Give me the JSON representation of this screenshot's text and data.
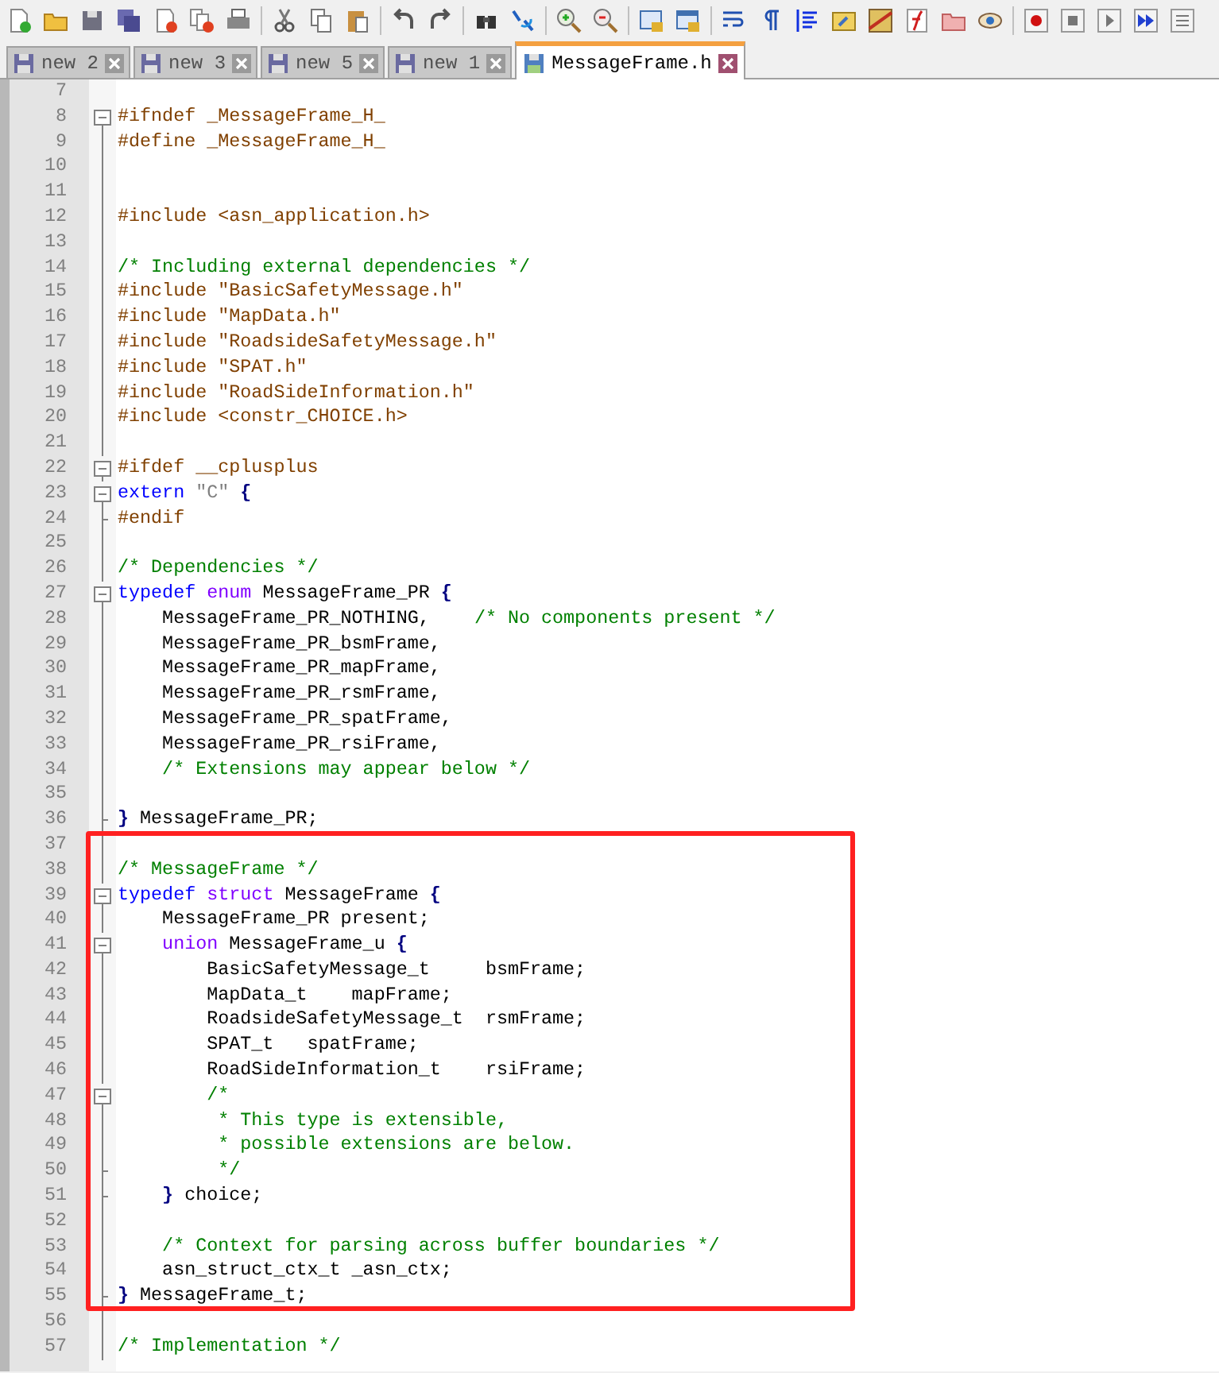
{
  "tabs": [
    {
      "label": "new 2",
      "selected": false
    },
    {
      "label": "new 3",
      "selected": false
    },
    {
      "label": "new 5",
      "selected": false
    },
    {
      "label": "new 1",
      "selected": false
    },
    {
      "label": "MessageFrame.h",
      "selected": true
    }
  ],
  "editor": {
    "lines": [
      {
        "number": "7",
        "kind": "plain"
      },
      {
        "number": "8",
        "kind": "opener",
        "segments": [
          {
            "kind": "preprocessor",
            "text": "#ifndef _MessageFrame_H_"
          }
        ]
      },
      {
        "number": "9",
        "kind": "plain",
        "segments": [
          {
            "kind": "preprocessor",
            "text": "#define _MessageFrame_H_"
          }
        ]
      },
      {
        "number": "10",
        "kind": "plain"
      },
      {
        "number": "11",
        "kind": "plain"
      },
      {
        "number": "12",
        "kind": "plain",
        "segments": [
          {
            "kind": "preprocessor",
            "text": "#include <asn_application.h>"
          }
        ]
      },
      {
        "number": "13",
        "kind": "plain"
      },
      {
        "number": "14",
        "kind": "plain",
        "segments": [
          {
            "kind": "comment",
            "text": "/* Including external dependencies */"
          }
        ]
      },
      {
        "number": "15",
        "kind": "plain",
        "segments": [
          {
            "kind": "preprocessor",
            "text": "#include \"BasicSafetyMessage.h\""
          }
        ]
      },
      {
        "number": "16",
        "kind": "plain",
        "segments": [
          {
            "kind": "preprocessor",
            "text": "#include \"MapData.h\""
          }
        ]
      },
      {
        "number": "17",
        "kind": "plain",
        "segments": [
          {
            "kind": "preprocessor",
            "text": "#include \"RoadsideSafetyMessage.h\""
          }
        ]
      },
      {
        "number": "18",
        "kind": "plain",
        "segments": [
          {
            "kind": "preprocessor",
            "text": "#include \"SPAT.h\""
          }
        ]
      },
      {
        "number": "19",
        "kind": "plain",
        "segments": [
          {
            "kind": "preprocessor",
            "text": "#include \"RoadSideInformation.h\""
          }
        ]
      },
      {
        "number": "20",
        "kind": "plain",
        "segments": [
          {
            "kind": "preprocessor",
            "text": "#include <constr_CHOICE.h>"
          }
        ]
      },
      {
        "number": "21",
        "kind": "plain"
      },
      {
        "number": "22",
        "kind": "opener",
        "segments": [
          {
            "kind": "preprocessor",
            "text": "#ifdef __cplusplus"
          }
        ]
      },
      {
        "number": "23",
        "kind": "opener",
        "segments": [
          {
            "kind": "keyword",
            "text": "extern"
          },
          {
            "kind": "string",
            "text": " \"C\" "
          },
          {
            "kind": "brace",
            "text": "{"
          }
        ]
      },
      {
        "number": "24",
        "kind": "closer",
        "segments": [
          {
            "kind": "preprocessor",
            "text": "#endif"
          }
        ]
      },
      {
        "number": "25",
        "kind": "plain"
      },
      {
        "number": "26",
        "kind": "plain",
        "segments": [
          {
            "kind": "comment",
            "text": "/* Dependencies */"
          }
        ]
      },
      {
        "number": "27",
        "kind": "opener",
        "segments": [
          {
            "kind": "keyword",
            "text": "typedef"
          },
          {
            "kind": "type",
            "text": " enum"
          },
          {
            "kind": "plain",
            "text": " MessageFrame_PR "
          },
          {
            "kind": "brace",
            "text": "{"
          }
        ]
      },
      {
        "number": "28",
        "kind": "plain",
        "segments": [
          {
            "kind": "plain",
            "text": "    MessageFrame_PR_NOTHING,    "
          },
          {
            "kind": "comment",
            "text": "/* No components present */"
          }
        ]
      },
      {
        "number": "29",
        "kind": "plain",
        "segments": [
          {
            "kind": "plain",
            "text": "    MessageFrame_PR_bsmFrame,"
          }
        ]
      },
      {
        "number": "30",
        "kind": "plain",
        "segments": [
          {
            "kind": "plain",
            "text": "    MessageFrame_PR_mapFrame,"
          }
        ]
      },
      {
        "number": "31",
        "kind": "plain",
        "segments": [
          {
            "kind": "plain",
            "text": "    MessageFrame_PR_rsmFrame,"
          }
        ]
      },
      {
        "number": "32",
        "kind": "plain",
        "segments": [
          {
            "kind": "plain",
            "text": "    MessageFrame_PR_spatFrame,"
          }
        ]
      },
      {
        "number": "33",
        "kind": "plain",
        "segments": [
          {
            "kind": "plain",
            "text": "    MessageFrame_PR_rsiFrame,"
          }
        ]
      },
      {
        "number": "34",
        "kind": "plain",
        "segments": [
          {
            "kind": "comment",
            "text": "    /* Extensions may appear below */"
          }
        ]
      },
      {
        "number": "35",
        "kind": "plain"
      },
      {
        "number": "36",
        "kind": "closer",
        "segments": [
          {
            "kind": "brace",
            "text": "}"
          },
          {
            "kind": "plain",
            "text": " MessageFrame_PR;"
          }
        ]
      }
    ],
    "marked_block": {
      "lines": [
        {
          "number": "37",
          "kind": "plain"
        },
        {
          "number": "38",
          "kind": "plain",
          "segments": [
            {
              "kind": "comment",
              "text": "/* MessageFrame */"
            }
          ]
        },
        {
          "number": "39",
          "kind": "opener",
          "segments": [
            {
              "kind": "keyword",
              "text": "typedef"
            },
            {
              "kind": "type",
              "text": " struct"
            },
            {
              "kind": "plain",
              "text": " MessageFrame "
            },
            {
              "kind": "brace",
              "text": "{"
            }
          ]
        },
        {
          "number": "40",
          "kind": "plain",
          "segments": [
            {
              "kind": "plain",
              "text": "    MessageFrame_PR present;"
            }
          ]
        },
        {
          "number": "41",
          "kind": "opener",
          "segments": [
            {
              "kind": "type",
              "text": "    union"
            },
            {
              "kind": "plain",
              "text": " MessageFrame_u "
            },
            {
              "kind": "brace",
              "text": "{"
            }
          ]
        },
        {
          "number": "42",
          "kind": "plain",
          "segments": [
            {
              "kind": "plain",
              "text": "        BasicSafetyMessage_t     bsmFrame;"
            }
          ]
        },
        {
          "number": "43",
          "kind": "plain",
          "segments": [
            {
              "kind": "plain",
              "text": "        MapData_t    mapFrame;"
            }
          ]
        },
        {
          "number": "44",
          "kind": "plain",
          "segments": [
            {
              "kind": "plain",
              "text": "        RoadsideSafetyMessage_t  rsmFrame;"
            }
          ]
        },
        {
          "number": "45",
          "kind": "plain",
          "segments": [
            {
              "kind": "plain",
              "text": "        SPAT_t   spatFrame;"
            }
          ]
        },
        {
          "number": "46",
          "kind": "plain",
          "segments": [
            {
              "kind": "plain",
              "text": "        RoadSideInformation_t    rsiFrame;"
            }
          ]
        },
        {
          "number": "47",
          "kind": "opener",
          "segments": [
            {
              "kind": "comment",
              "text": "        /*"
            }
          ]
        },
        {
          "number": "48",
          "kind": "plain",
          "segments": [
            {
              "kind": "comment",
              "text": "         * This type is extensible,"
            }
          ]
        },
        {
          "number": "49",
          "kind": "plain",
          "segments": [
            {
              "kind": "comment",
              "text": "         * possible extensions are below."
            }
          ]
        },
        {
          "number": "50",
          "kind": "closer",
          "segments": [
            {
              "kind": "comment",
              "text": "         */"
            }
          ]
        },
        {
          "number": "51",
          "kind": "closer",
          "segments": [
            {
              "kind": "brace",
              "text": "    }"
            },
            {
              "kind": "plain",
              "text": " choice;"
            }
          ]
        },
        {
          "number": "52",
          "kind": "plain"
        },
        {
          "number": "53",
          "kind": "plain",
          "segments": [
            {
              "kind": "comment",
              "text": "    /* Context for parsing across buffer boundaries */"
            }
          ]
        },
        {
          "number": "54",
          "kind": "plain",
          "segments": [
            {
              "kind": "plain",
              "text": "    asn_struct_ctx_t _asn_ctx;"
            }
          ]
        },
        {
          "number": "55",
          "kind": "closer",
          "segments": [
            {
              "kind": "brace",
              "text": "}"
            },
            {
              "kind": "plain",
              "text": " MessageFrame_t;"
            }
          ]
        }
      ]
    },
    "lines_after": [
      {
        "number": "56",
        "kind": "plain"
      },
      {
        "number": "57",
        "kind": "plain",
        "segments": [
          {
            "kind": "comment",
            "text": "/* Implementation */"
          }
        ]
      }
    ]
  }
}
